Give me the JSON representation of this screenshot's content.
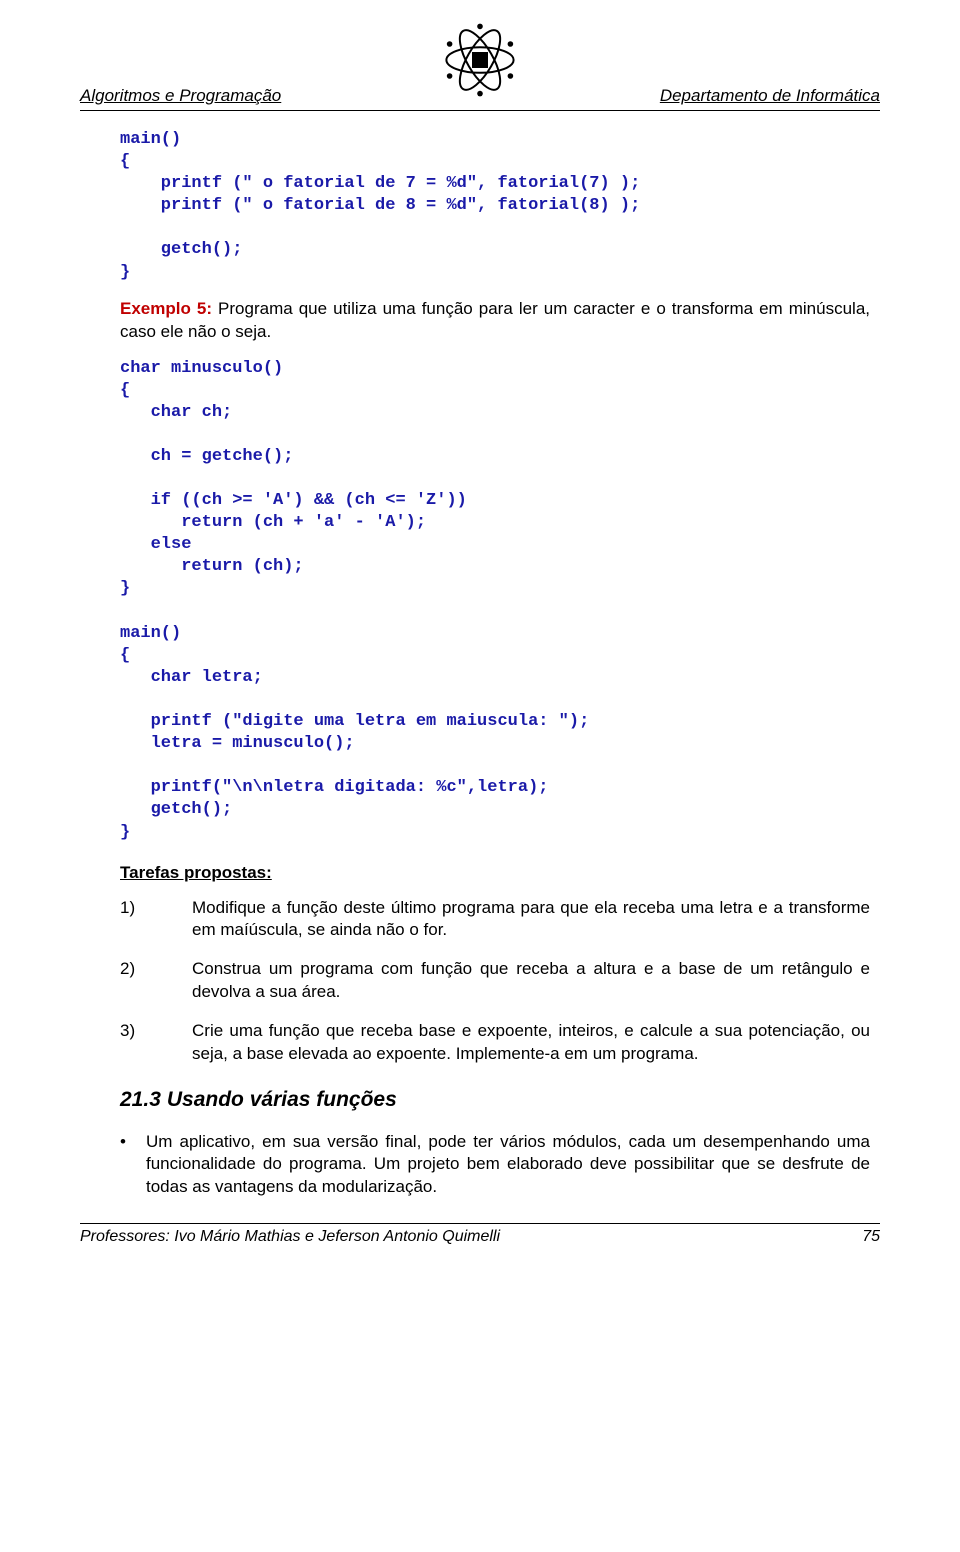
{
  "header": {
    "left": "Algoritmos e Programação",
    "right": "Departamento de Informática"
  },
  "code1": "main()\n{\n    printf (\" o fatorial de 7 = %d\", fatorial(7) );\n    printf (\" o fatorial de 8 = %d\", fatorial(8) );\n\n    getch();\n}",
  "example": {
    "label": "Exemplo 5:",
    "text": " Programa que utiliza uma função para ler um caracter e o transforma em minúscula, caso ele não o seja."
  },
  "code2": "char minusculo()\n{\n   char ch;\n\n   ch = getche();\n\n   if ((ch >= 'A') && (ch <= 'Z'))\n      return (ch + 'a' - 'A');\n   else\n      return (ch);\n}\n\nmain()\n{\n   char letra;\n\n   printf (\"digite uma letra em maiuscula: \");\n   letra = minusculo();\n\n   printf(\"\\n\\nletra digitada: %c\",letra);\n   getch();\n}",
  "tasksHeading": "Tarefas propostas:",
  "tasks": [
    {
      "num": "1)",
      "text": "Modifique a função deste último programa para que ela receba uma letra e a transforme em maíúscula, se ainda não o for."
    },
    {
      "num": "2)",
      "text": "Construa um programa com função que receba a altura e a base de um retângulo e devolva a sua área."
    },
    {
      "num": "3)",
      "text": "Crie uma função que receba base e expoente, inteiros, e calcule a sua potenciação, ou seja, a base elevada ao expoente. Implemente-a em um programa."
    }
  ],
  "section": {
    "num": "21.3",
    "title": "Usando várias funções"
  },
  "bullet": "Um aplicativo, em sua versão final, pode ter vários módulos, cada um desempenhando uma funcionalidade do programa. Um projeto bem elaborado deve possibilitar que se desfrute de todas as vantagens da modularização.",
  "footer": {
    "left": "Professores: Ivo Mário Mathias e Jeferson Antonio Quimelli",
    "right": "75"
  }
}
